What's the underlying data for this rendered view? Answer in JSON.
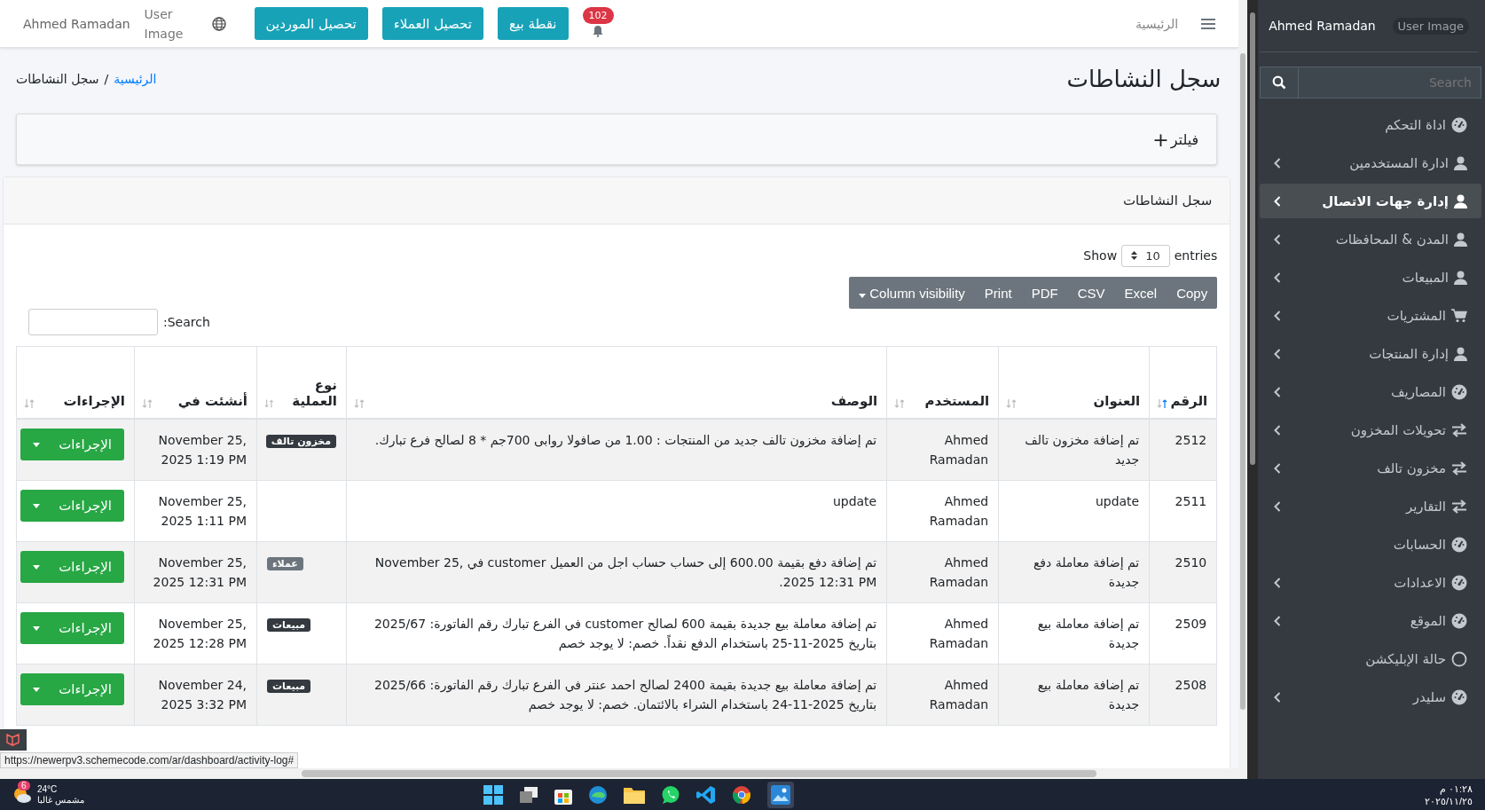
{
  "navbar": {
    "home_link": "الرئيسية",
    "notifications_count": "102",
    "buttons": [
      "نقطة بيع",
      "تحصيل العملاء",
      "تحصيل الموردين"
    ],
    "user_image_alt": "User Image",
    "user_name": "Ahmed Ramadan"
  },
  "page": {
    "title": "سجل النشاطات",
    "breadcrumb": [
      {
        "label": "الرئيسية",
        "link": true
      },
      {
        "label": "سجل النشاطات",
        "link": false
      }
    ],
    "separator": "/"
  },
  "filter": {
    "icon": "+",
    "label": "فيلتر"
  },
  "card": {
    "title": "سجل النشاطات",
    "length": {
      "show": "Show",
      "value": "10",
      "entries": "entries"
    },
    "export_buttons": [
      {
        "label": "Copy",
        "kind": "plain"
      },
      {
        "label": "Excel",
        "kind": "plain"
      },
      {
        "label": "CSV",
        "kind": "plain"
      },
      {
        "label": "PDF",
        "kind": "plain"
      },
      {
        "label": "Print",
        "kind": "plain"
      },
      {
        "label": "Column visibility",
        "kind": "dropdown"
      }
    ],
    "search": {
      "label": "Search:"
    },
    "table": {
      "columns": [
        {
          "label": "الرقم",
          "sorted": true
        },
        {
          "label": "العنوان",
          "sorted": false
        },
        {
          "label": "المستخدم",
          "sorted": false
        },
        {
          "label": "الوصف",
          "sorted": false
        },
        {
          "label": "نوع العملية",
          "sorted": false
        },
        {
          "label": "أنشئت في",
          "sorted": false
        },
        {
          "label": "الإجراءات",
          "sorted": false
        }
      ],
      "rows": [
        {
          "id": "2512",
          "title": "تم إضافة مخزون تالف جديد",
          "user": "Ahmed Ramadan",
          "description": "تم إضافة مخزون تالف جديد من المنتجات : 1.00 من صافولا روابى 700جم * 8 لصالح فرع تبارك.",
          "type": {
            "label": "مخزون تالف",
            "color": "#343a40"
          },
          "created": "November 25, 2025 1:19 PM",
          "action": "الإجراءات"
        },
        {
          "id": "2511",
          "title": "update",
          "user": "Ahmed Ramadan",
          "description": "update",
          "created": "November 25, 2025 1:11 PM",
          "action": "الإجراءات"
        },
        {
          "id": "2510",
          "title": "تم إضافة معاملة دفع جديدة",
          "user": "Ahmed Ramadan",
          "description": "تم إضافة دفع بقيمة 600.00 إلى حساب حساب اجل من العميل customer في November 25, 2025 12:31 PM.",
          "type": {
            "label": "عملاء",
            "color": "#6c757d"
          },
          "created": "November 25, 2025 12:31 PM",
          "action": "الإجراءات"
        },
        {
          "id": "2509",
          "title": "تم إضافة معاملة بيع جديدة",
          "user": "Ahmed Ramadan",
          "description": "تم إضافة معاملة بيع جديدة بقيمة 600 لصالح customer في الفرع تبارك رقم الفاتورة: 2025/67 بتاريخ 2025-11-25 باستخدام الدفع نقداً. خصم: لا يوجد خصم",
          "type": {
            "label": "مبيعات",
            "color": "#343a40"
          },
          "created": "November 25, 2025 12:28 PM",
          "action": "الإجراءات"
        },
        {
          "id": "2508",
          "title": "تم إضافة معاملة بيع جديدة",
          "user": "Ahmed Ramadan",
          "description": "تم إضافة معاملة بيع جديدة بقيمة 2400 لصالح احمد عنتر في الفرع تبارك رقم الفاتورة: 2025/66 بتاريخ 2025-11-24 باستخدام الشراء بالائتمان. خصم: لا يوجد خصم",
          "type": {
            "label": "مبيعات",
            "color": "#343a40"
          },
          "created": "November 24, 2025 3:32 PM",
          "action": "الإجراءات"
        }
      ]
    }
  },
  "status_url": "https://newerpv3.schemecode.com/ar/dashboard/activity-log#",
  "sidebar": {
    "user_name": "Ahmed Ramadan",
    "user_image_alt": "User Image",
    "search": {
      "placeholder": "Search"
    },
    "items": [
      {
        "label": "اداة التحكم",
        "kind": "gauge",
        "arrow": false,
        "selected": false
      },
      {
        "label": "ادارة المستخدمين",
        "kind": "user",
        "arrow": true,
        "selected": false
      },
      {
        "label": "إدارة جهات الاتصال",
        "kind": "user",
        "arrow": true,
        "selected": true
      },
      {
        "label": "المدن & المحافظات",
        "kind": "user",
        "arrow": true,
        "selected": false
      },
      {
        "label": "المبيعات",
        "kind": "user",
        "arrow": true,
        "selected": false
      },
      {
        "label": "المشتريات",
        "kind": "cart",
        "arrow": true,
        "selected": false
      },
      {
        "label": "إدارة المنتجات",
        "kind": "user",
        "arrow": true,
        "selected": false
      },
      {
        "label": "المصاريف",
        "kind": "gauge",
        "arrow": true,
        "selected": false
      },
      {
        "label": "تحويلات المخزون",
        "kind": "exchange",
        "arrow": true,
        "selected": false
      },
      {
        "label": "مخزون تالف",
        "kind": "exchange",
        "arrow": true,
        "selected": false
      },
      {
        "label": "التقارير",
        "kind": "exchange",
        "arrow": true,
        "selected": false
      },
      {
        "label": "الحسابات",
        "kind": "gauge",
        "arrow": false,
        "selected": false
      },
      {
        "label": "الاعدادات",
        "kind": "gauge",
        "arrow": true,
        "selected": false
      },
      {
        "label": "الموقع",
        "kind": "gauge",
        "arrow": true,
        "selected": false
      },
      {
        "label": "حالة الإبليكشن",
        "kind": "circle",
        "arrow": false,
        "selected": false
      },
      {
        "label": "سليدر",
        "kind": "gauge",
        "arrow": true,
        "selected": false
      }
    ]
  },
  "taskbar": {
    "weather": {
      "badge": "6",
      "temperature": "24°C",
      "condition": "مشمس غالبا"
    },
    "time": "٠١:٢٨ م",
    "date": "٢٠٢٥/١١/٢٥"
  }
}
